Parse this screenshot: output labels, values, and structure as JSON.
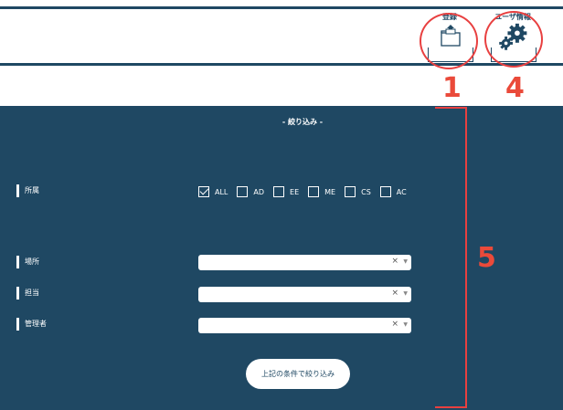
{
  "header": {
    "register_label": "登録",
    "user_info_label": "ユーザ情報",
    "register_icon": "folder-upload-icon",
    "user_info_icon": "gear-icon"
  },
  "annotations": [
    "1",
    "4",
    "5"
  ],
  "filter": {
    "title": "- 絞り込み -",
    "affiliation_label": "所属",
    "affiliation_options": [
      {
        "label": "ALL",
        "checked": true
      },
      {
        "label": "AD",
        "checked": false
      },
      {
        "label": "EE",
        "checked": false
      },
      {
        "label": "ME",
        "checked": false
      },
      {
        "label": "CS",
        "checked": false
      },
      {
        "label": "AC",
        "checked": false
      }
    ],
    "location_label": "場所",
    "person_label": "担当",
    "manager_label": "管理者",
    "clear_symbol": "×",
    "caret_symbol": "▼",
    "submit_label": "上記の条件で絞り込み"
  },
  "colors": {
    "panel": "#1f4863",
    "annotation": "#e84040"
  }
}
